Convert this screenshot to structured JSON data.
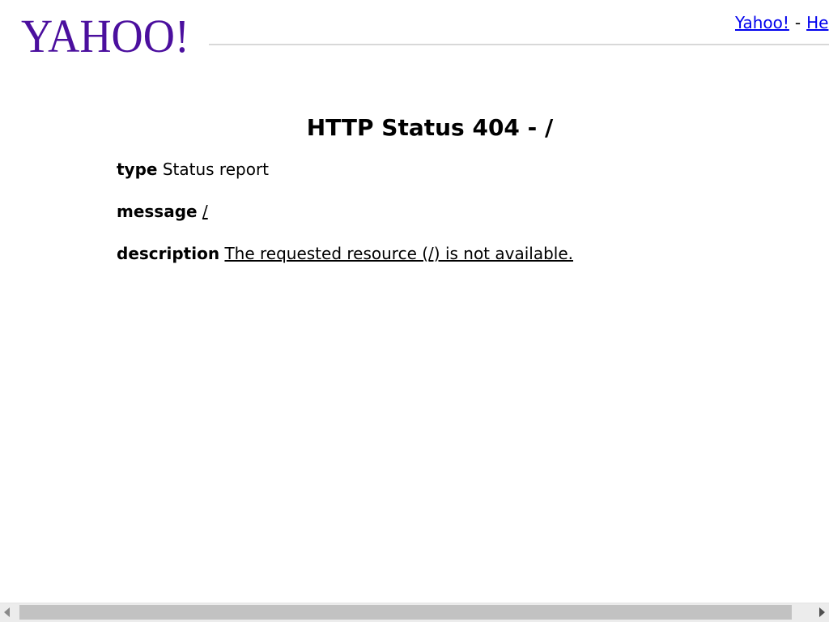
{
  "header": {
    "logo_text": "YAHOO!",
    "logo_color": "#4b0f9e",
    "links": [
      {
        "label": "Yahoo!"
      },
      {
        "separator": "-"
      },
      {
        "label": "He"
      }
    ]
  },
  "error": {
    "title": "HTTP Status 404 - /",
    "type_label": "type",
    "type_value": "Status report",
    "message_label": "message",
    "message_value": "/",
    "description_label": "description",
    "description_value": "The requested resource (/) is not available."
  },
  "scrollbar": {
    "orientation": "horizontal",
    "icons": [
      "arrow-left-icon",
      "arrow-right-icon"
    ]
  }
}
